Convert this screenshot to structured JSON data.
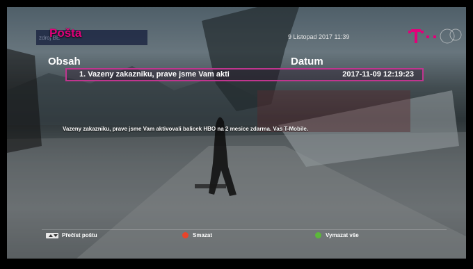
{
  "header": {
    "title": "Pošta",
    "background_label": "zdroj BE",
    "datetime": "9 Listopad 2017 11:39",
    "logo": "T-Mobile logo"
  },
  "columns": {
    "subject_header": "Obsah",
    "date_header": "Datum"
  },
  "messages": [
    {
      "subject": "1. Vazeny zakazniku, prave jsme Vam akti",
      "date": "2017-11-09 12:19:23",
      "selected": true
    }
  ],
  "message_body": "Vazeny zakazniku, prave jsme Vam aktivovali balicek HBO na 2 mesice zdarma. Vas T-Mobile.",
  "footer": {
    "read_label": "Přečíst poštu",
    "delete_label": "Smazat",
    "delete_all_label": "Vymazat vše"
  },
  "colors": {
    "accent": "#e2007a",
    "red_button": "#e8442a",
    "green_button": "#5cb83a"
  }
}
